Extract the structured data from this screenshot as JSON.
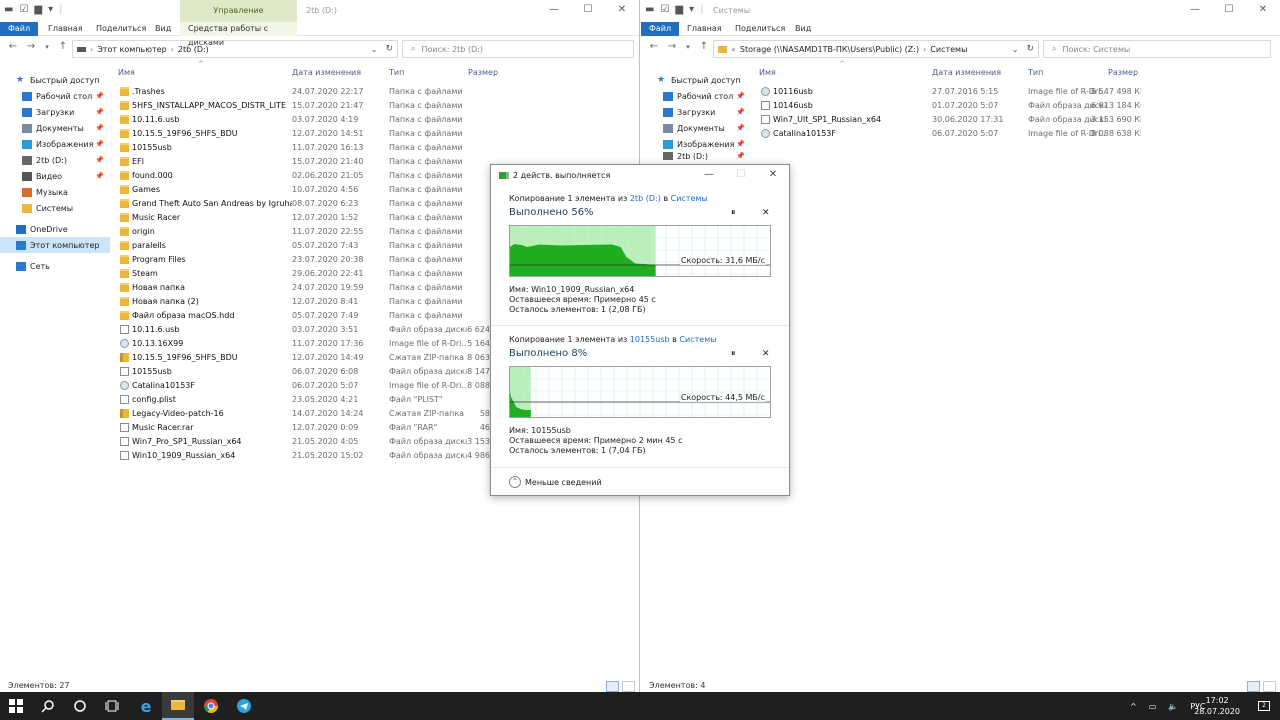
{
  "left": {
    "qat_symbols": [
      "▬",
      "☑",
      "▆",
      "▾"
    ],
    "manage_label": "Управление",
    "title": "2tb (D:)",
    "ribbon": {
      "file": "Файл",
      "home": "Главная",
      "share": "Поделиться",
      "view": "Вид",
      "tools": "Средства работы с дисками"
    },
    "path": [
      "Этот компьютер",
      "2tb (D:)"
    ],
    "search_placeholder": "Поиск: 2tb (D:)",
    "columns": {
      "name": "Имя",
      "date": "Дата изменения",
      "type": "Тип",
      "size": "Размер"
    },
    "files": [
      {
        "name": ".Trashes",
        "date": "24.07.2020 22:17",
        "type": "Папка с файлами",
        "size": "",
        "icon": "folder"
      },
      {
        "name": "5HFS_INSTALLAPP_MACOS_DISTR_LITE",
        "date": "15.07.2020 21:47",
        "type": "Папка с файлами",
        "size": "",
        "icon": "folder"
      },
      {
        "name": "10.11.6.usb",
        "date": "03.07.2020 4:19",
        "type": "Папка с файлами",
        "size": "",
        "icon": "folder"
      },
      {
        "name": "10.15.5_19F96_5HFS_BDU",
        "date": "12.07.2020 14:51",
        "type": "Папка с файлами",
        "size": "",
        "icon": "folder"
      },
      {
        "name": "10155usb",
        "date": "11.07.2020 16:13",
        "type": "Папка с файлами",
        "size": "",
        "icon": "folder"
      },
      {
        "name": "EFI",
        "date": "15.07.2020 21:40",
        "type": "Папка с файлами",
        "size": "",
        "icon": "folder"
      },
      {
        "name": "found.000",
        "date": "02.06.2020 21:05",
        "type": "Папка с файлами",
        "size": "",
        "icon": "folder"
      },
      {
        "name": "Games",
        "date": "10.07.2020 4:56",
        "type": "Папка с файлами",
        "size": "",
        "icon": "folder"
      },
      {
        "name": "Grand Theft Auto San Andreas by Igruha",
        "date": "08.07.2020 6:23",
        "type": "Папка с файлами",
        "size": "",
        "icon": "folder"
      },
      {
        "name": "Music Racer",
        "date": "12.07.2020 1:52",
        "type": "Папка с файлами",
        "size": "",
        "icon": "folder"
      },
      {
        "name": "origin",
        "date": "11.07.2020 22:55",
        "type": "Папка с файлами",
        "size": "",
        "icon": "folder"
      },
      {
        "name": "paralells",
        "date": "05.07.2020 7:43",
        "type": "Папка с файлами",
        "size": "",
        "icon": "folder"
      },
      {
        "name": "Program Files",
        "date": "23.07.2020 20:38",
        "type": "Папка с файлами",
        "size": "",
        "icon": "folder"
      },
      {
        "name": "Steam",
        "date": "29.06.2020 22:41",
        "type": "Папка с файлами",
        "size": "",
        "icon": "folder"
      },
      {
        "name": "Новая папка",
        "date": "24.07.2020 19:59",
        "type": "Папка с файлами",
        "size": "",
        "icon": "folder"
      },
      {
        "name": "Новая папка (2)",
        "date": "12.07.2020 8:41",
        "type": "Папка с файлами",
        "size": "",
        "icon": "folder"
      },
      {
        "name": "Файл образа macOS.hdd",
        "date": "05.07.2020 7:49",
        "type": "Папка с файлами",
        "size": "",
        "icon": "folder"
      },
      {
        "name": "10.11.6.usb",
        "date": "03.07.2020 3:51",
        "type": "Файл образа диска",
        "size": "6 624",
        "icon": "doc"
      },
      {
        "name": "10.13.16X99",
        "date": "11.07.2020 17:36",
        "type": "Image file of R-Dri...",
        "size": "5 164",
        "icon": "disk"
      },
      {
        "name": "10.15.5_19F96_5HFS_BDU",
        "date": "12.07.2020 14:49",
        "type": "Сжатая ZIP-папка",
        "size": "8 063",
        "icon": "zip"
      },
      {
        "name": "10155usb",
        "date": "06.07.2020 6:08",
        "type": "Файл образа диска",
        "size": "8 147",
        "icon": "doc"
      },
      {
        "name": "Catalina10153F",
        "date": "06.07.2020 5:07",
        "type": "Image file of R-Dri...",
        "size": "8 088",
        "icon": "disk"
      },
      {
        "name": "config.plist",
        "date": "23.05.2020 4:21",
        "type": "Файл \"PLIST\"",
        "size": "",
        "icon": "doc"
      },
      {
        "name": "Legacy-Video-patch-16",
        "date": "14.07.2020 14:24",
        "type": "Сжатая ZIP-папка",
        "size": "58",
        "icon": "zip"
      },
      {
        "name": "Music Racer.rar",
        "date": "12.07.2020 0:09",
        "type": "Файл \"RAR\"",
        "size": "46",
        "icon": "doc"
      },
      {
        "name": "Win7_Pro_SP1_Russian_x64",
        "date": "21.05.2020 4:05",
        "type": "Файл образа диска",
        "size": "3 153",
        "icon": "doc"
      },
      {
        "name": "Win10_1909_Russian_x64",
        "date": "21.05.2020 15:02",
        "type": "Файл образа диска",
        "size": "4 986",
        "icon": "doc"
      }
    ],
    "status": "Элементов: 27"
  },
  "right": {
    "title": "Системы",
    "ribbon": {
      "file": "Файл",
      "home": "Главная",
      "share": "Поделиться",
      "view": "Вид"
    },
    "path": [
      "Storage (\\\\NASAMD1TB-ПК\\Users\\Public) (Z:)",
      "Системы"
    ],
    "search_placeholder": "Поиск: Системы",
    "columns": {
      "name": "Имя",
      "date": "Дата изменения",
      "type": "Тип",
      "size": "Размер"
    },
    "files": [
      {
        "name": "10116usb",
        "date": "27.07.2016 5:15",
        "type": "Image file of R-Dri...",
        "size": "6 547 498 КБ",
        "icon": "disk"
      },
      {
        "name": "10146usb",
        "date": "01.07.2020 5:07",
        "type": "Файл образа диска",
        "size": "6 013 184 КБ",
        "icon": "doc"
      },
      {
        "name": "Win7_Ult_SP1_Russian_x64",
        "date": "30.06.2020 17:31",
        "type": "Файл образа диска",
        "size": "3 153 690 КБ",
        "icon": "doc"
      },
      {
        "name": "Catalina10153F",
        "date": "06.07.2020 5:07",
        "type": "Image file of R-Dri...",
        "size": "8 088 638 КБ",
        "icon": "disk"
      }
    ],
    "status": "Элементов: 4"
  },
  "nav": [
    {
      "label": "Быстрый доступ",
      "icon": "star-icon",
      "pinned": false
    },
    {
      "label": "Рабочий стол",
      "icon": "desktop-icon",
      "pinned": true
    },
    {
      "label": "Загрузки",
      "icon": "download-icon",
      "pinned": true
    },
    {
      "label": "Документы",
      "icon": "documents-icon",
      "pinned": true
    },
    {
      "label": "Изображения",
      "icon": "pictures-icon",
      "pinned": true
    },
    {
      "label": "2tb (D:)",
      "icon": "drive-icon",
      "pinned": true
    },
    {
      "label": "Видео",
      "icon": "video-icon",
      "pinned": true
    },
    {
      "label": "Музыка",
      "icon": "music-icon",
      "pinned": false
    },
    {
      "label": "Системы",
      "icon": "folder-icon",
      "pinned": false
    },
    {
      "label": "OneDrive",
      "icon": "cloud-icon",
      "pinned": false
    },
    {
      "label": "Этот компьютер",
      "icon": "computer-icon",
      "pinned": false
    },
    {
      "label": "Сеть",
      "icon": "network-icon",
      "pinned": false
    }
  ],
  "nav_right_partial": "2tb (D:)",
  "dialog": {
    "title": "2 действ. выполняется",
    "op1": {
      "prefix": "Копирование 1 элемента из ",
      "src": "2tb (D:)",
      "mid": " в ",
      "dst": "Системы",
      "progress_text": "Выполнено 56%",
      "progress": 0.56,
      "speed": "Скорость: 31,6 МБ/с",
      "name_label": "Имя:",
      "name_value": "Win10_1909_Russian_x64",
      "time_label": "Оставшееся время:",
      "time_value": "Примерно 45 с",
      "left_label": "Осталось элементов:",
      "left_value": "1 (2,08 ГБ)"
    },
    "op2": {
      "prefix": "Копирование 1 элемента из ",
      "src": "10155usb",
      "mid": " в ",
      "dst": "Системы",
      "progress_text": "Выполнено 8%",
      "progress": 0.08,
      "speed": "Скорость: 44,5 МБ/с",
      "name_label": "Имя:",
      "name_value": "10155usb",
      "time_label": "Оставшееся время:",
      "time_value": "Примерно 2 мин 45 с",
      "left_label": "Осталось элементов:",
      "left_value": "1 (7,04 ГБ)"
    },
    "less_label": "Меньше сведений",
    "pause_symbol": "⏸",
    "cancel_symbol": "✕"
  },
  "taskbar": {
    "lang": "РУС",
    "time": "17:02",
    "date": "28.07.2020",
    "notif_count": "2"
  },
  "colors": {
    "accent": "#1f6ec2",
    "graph_fill": "#99e699",
    "graph_line": "#2fa82f",
    "manage": "#dfe9c8"
  }
}
